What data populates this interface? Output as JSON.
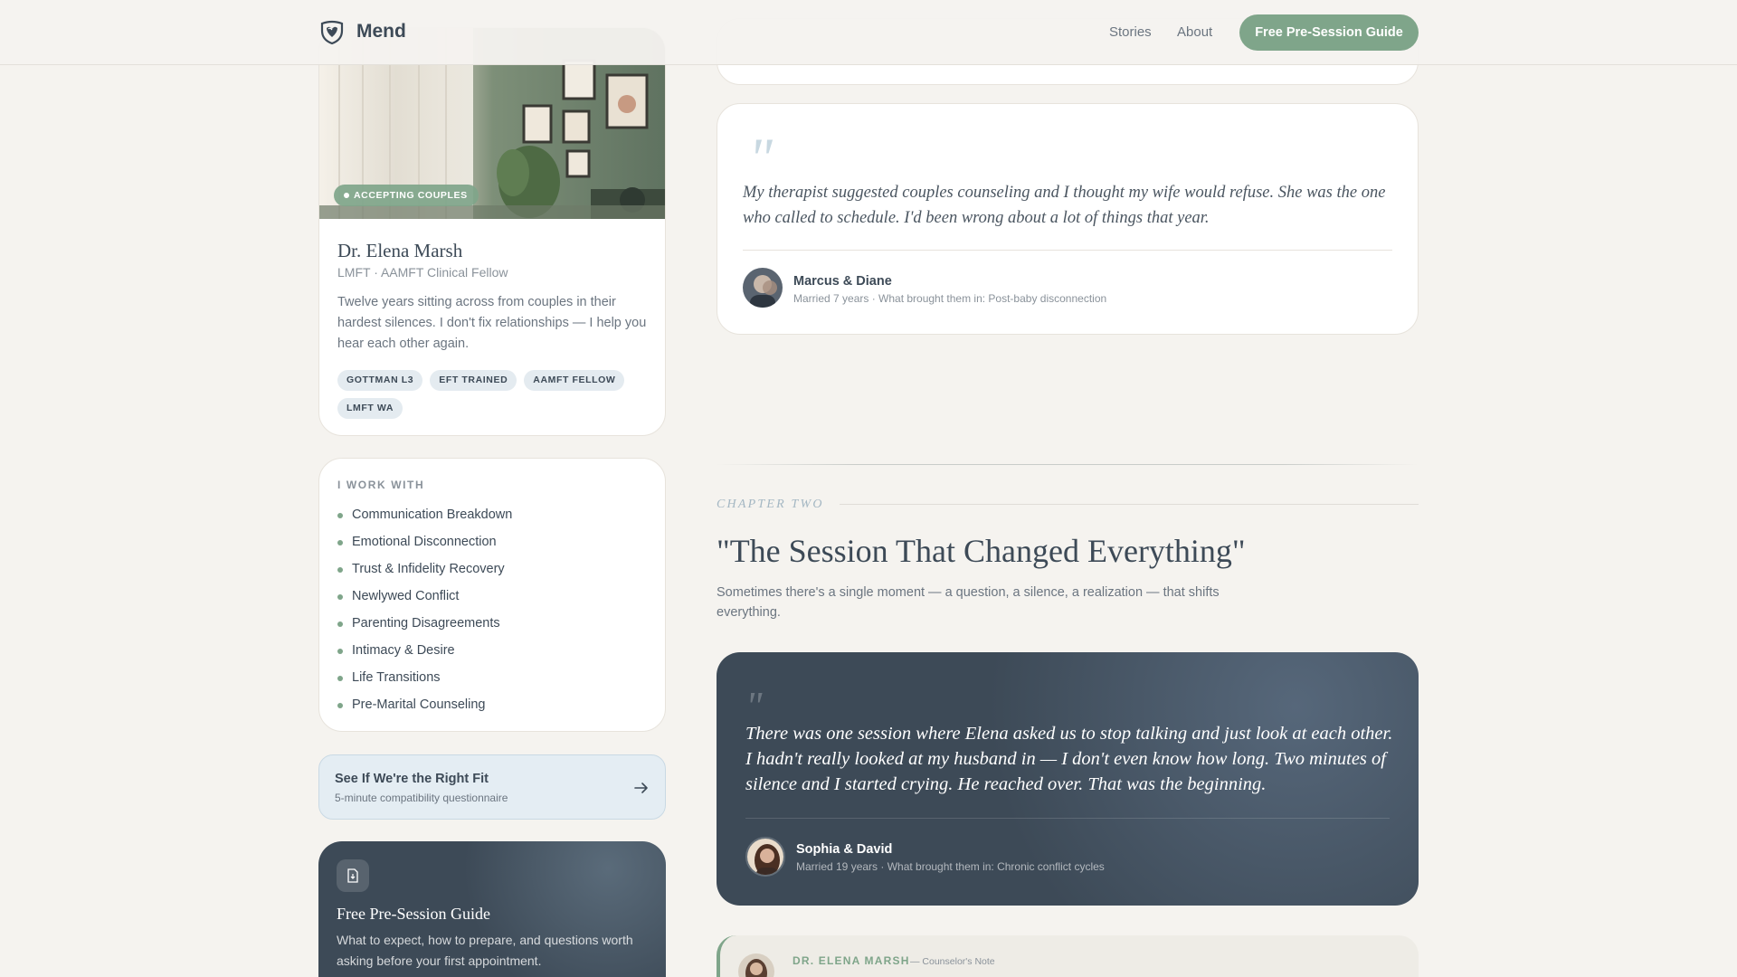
{
  "header": {
    "brand": "Mend",
    "nav": [
      "Stories",
      "About"
    ],
    "cta": "Free Pre-Session Guide"
  },
  "profile": {
    "status_badge": "ACCEPTING COUPLES",
    "name": "Dr. Elena Marsh",
    "credentials": "LMFT · AAMFT Clinical Fellow",
    "bio": "Twelve years sitting across from couples in their hardest silences. I don't fix relationships — I help you hear each other again.",
    "tags": [
      "GOTTMAN L3",
      "EFT TRAINED",
      "AAMFT FELLOW",
      "LMFT WA"
    ]
  },
  "work_with": {
    "title": "I WORK WITH",
    "items": [
      "Communication Breakdown",
      "Emotional Disconnection",
      "Trust & Infidelity Recovery",
      "Newlywed Conflict",
      "Parenting Disagreements",
      "Intimacy & Desire",
      "Life Transitions",
      "Pre-Marital Counseling"
    ]
  },
  "fit": {
    "title": "See If We're the Right Fit",
    "subtitle": "5-minute compatibility questionnaire"
  },
  "guide": {
    "title": "Free Pre-Session Guide",
    "description": "What to expect, how to prepare, and questions worth asking before your first appointment."
  },
  "testimonial_1": {
    "quote": "My therapist suggested couples counseling and I thought my wife would refuse. She was the one who called to schedule. I'd been wrong about a lot of things that year.",
    "couple": "Marcus & Diane",
    "meta": "Married 7 years · What brought them in: Post-baby disconnection"
  },
  "chapter": {
    "label": "CHAPTER TWO",
    "title": "\"The Session That Changed Everything\"",
    "description": "Sometimes there's a single moment — a question, a silence, a realization — that shifts everything."
  },
  "testimonial_2": {
    "quote": "There was one session where Elena asked us to stop talking and just look at each other. I hadn't really looked at my husband in — I don't even know how long. Two minutes of silence and I started crying. He reached over. That was the beginning.",
    "couple": "Sophia & David",
    "meta": "Married 19 years · What brought them in: Chronic conflict cycles"
  },
  "counselor_note": {
    "author": "DR. ELENA MARSH",
    "role": "— Counselor's Note"
  },
  "colors": {
    "accent": "#7fa58a",
    "dark": "#3d4a57",
    "background": "#f5f3ef"
  }
}
